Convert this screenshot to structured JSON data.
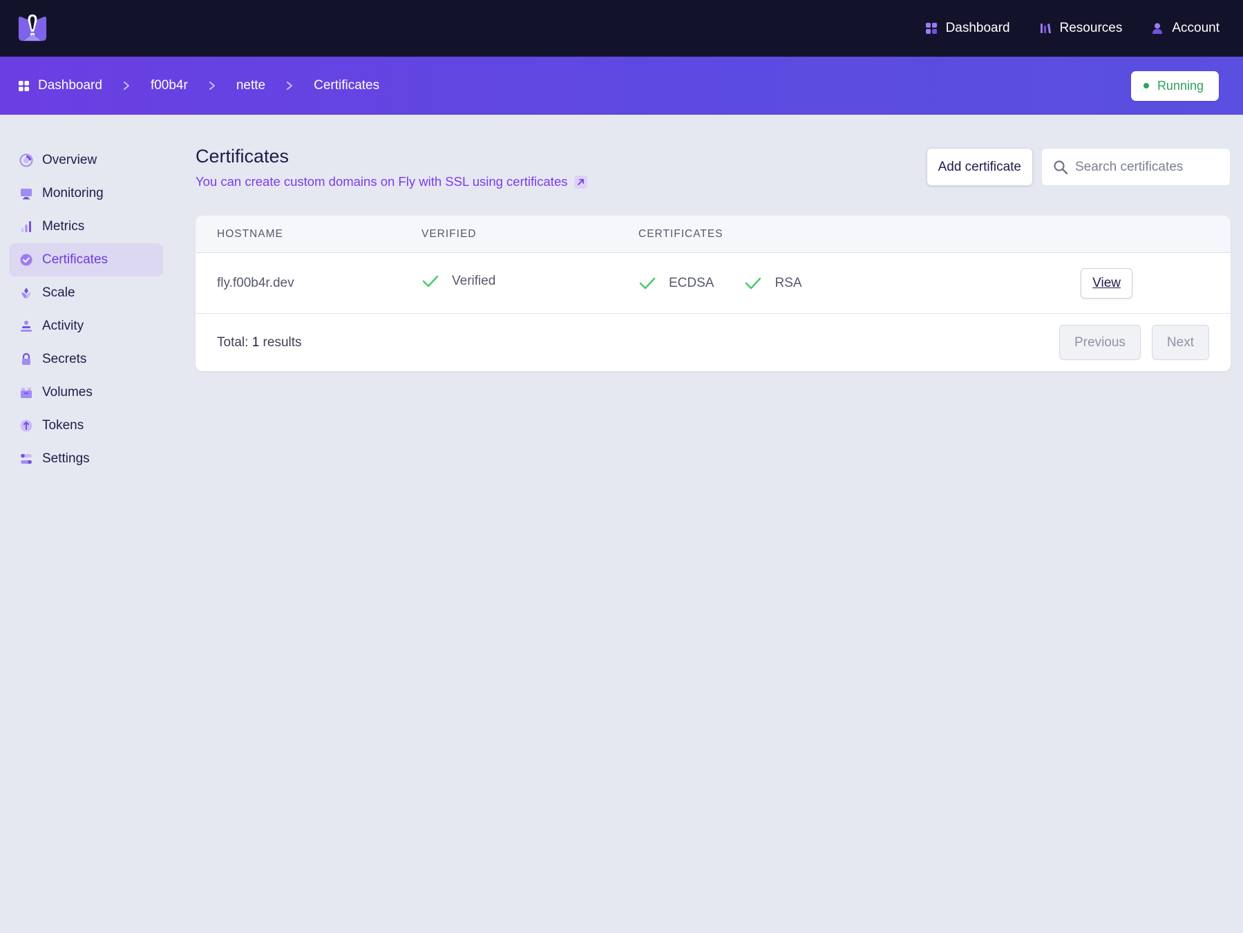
{
  "topnav": {
    "logo_icon": "fly-balloon-logo",
    "items": [
      {
        "label": "Dashboard",
        "icon": "grid-icon"
      },
      {
        "label": "Resources",
        "icon": "bars-icon"
      },
      {
        "label": "Account",
        "icon": "user-icon"
      }
    ]
  },
  "breadcrumb": {
    "items": [
      "Dashboard",
      "f00b4r",
      "nette",
      "Certificates"
    ],
    "status": "Running",
    "status_color": "#2fa35b"
  },
  "sidebar": {
    "items": [
      {
        "label": "Overview",
        "icon": "pie-chart-icon"
      },
      {
        "label": "Monitoring",
        "icon": "monitor-icon"
      },
      {
        "label": "Metrics",
        "icon": "bar-chart-icon"
      },
      {
        "label": "Certificates",
        "icon": "badge-check-icon",
        "active": true
      },
      {
        "label": "Scale",
        "icon": "scale-icon"
      },
      {
        "label": "Activity",
        "icon": "activity-stack-icon"
      },
      {
        "label": "Secrets",
        "icon": "lock-icon"
      },
      {
        "label": "Volumes",
        "icon": "archive-icon"
      },
      {
        "label": "Tokens",
        "icon": "token-icon"
      },
      {
        "label": "Settings",
        "icon": "toggles-icon"
      }
    ]
  },
  "main": {
    "title": "Certificates",
    "subtitle": "You can create custom domains on Fly with SSL using certificates",
    "add_button": "Add certificate",
    "search_placeholder": "Search certificates",
    "table": {
      "columns": [
        "HOSTNAME",
        "VERIFIED",
        "CERTIFICATES"
      ],
      "rows": [
        {
          "hostname": "fly.f00b4r.dev",
          "verified": "Verified",
          "certs": [
            "ECDSA",
            "RSA"
          ],
          "action": "View"
        }
      ],
      "total_prefix": "Total: ",
      "total_count": "1",
      "total_suffix": " results",
      "prev": "Previous",
      "next": "Next"
    }
  },
  "colors": {
    "accent": "#7c3aed",
    "topbar": "#12132a",
    "check": "#4ccb6f"
  }
}
